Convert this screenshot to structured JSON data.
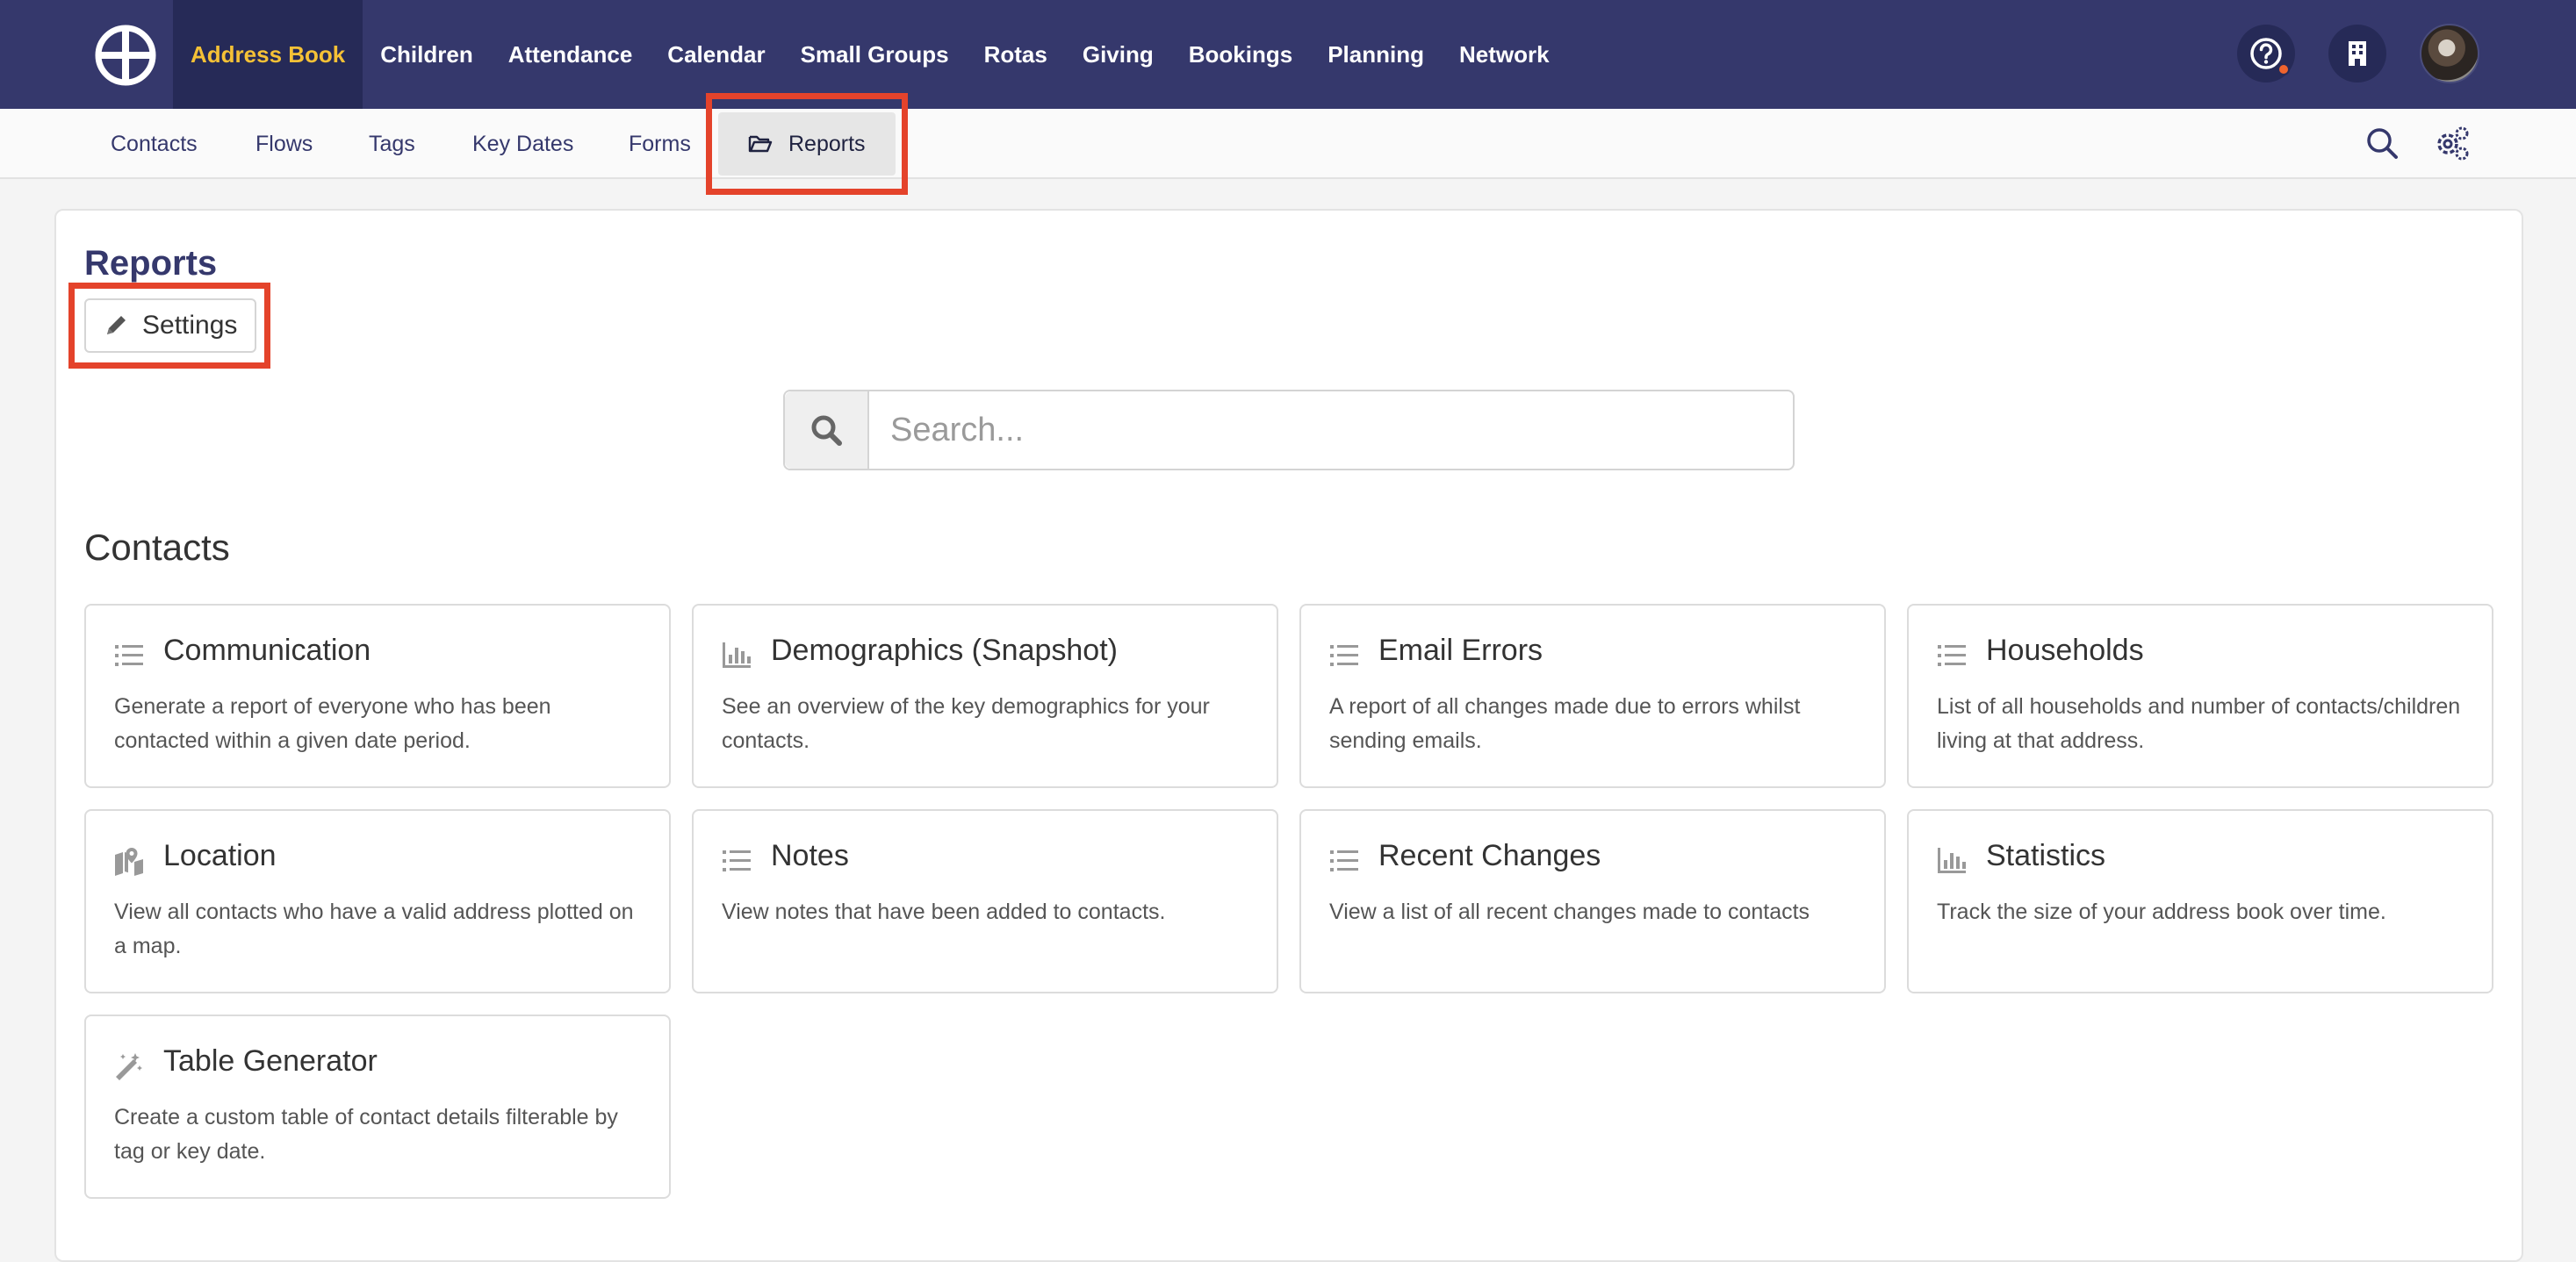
{
  "topnav": {
    "items": [
      {
        "label": "Address Book",
        "active": true
      },
      {
        "label": "Children"
      },
      {
        "label": "Attendance"
      },
      {
        "label": "Calendar"
      },
      {
        "label": "Small Groups"
      },
      {
        "label": "Rotas"
      },
      {
        "label": "Giving"
      },
      {
        "label": "Bookings"
      },
      {
        "label": "Planning"
      },
      {
        "label": "Network"
      }
    ],
    "active_color": "#f5c136",
    "background": "#35386c",
    "icons": [
      "help-icon",
      "building-icon",
      "avatar"
    ]
  },
  "subnav": {
    "items": [
      {
        "label": "Contacts"
      },
      {
        "label": "Flows"
      },
      {
        "label": "Tags"
      },
      {
        "label": "Key Dates"
      },
      {
        "label": "Forms"
      },
      {
        "label": "Reports",
        "active": true,
        "icon": "folder-open-icon"
      }
    ],
    "icons": [
      "search-icon",
      "cogs-icon"
    ]
  },
  "page": {
    "title": "Reports",
    "settings_label": "Settings"
  },
  "search": {
    "placeholder": "Search..."
  },
  "section": {
    "title": "Contacts"
  },
  "cards": [
    {
      "title": "Communication",
      "icon": "list-icon",
      "desc": "Generate a report of everyone who has been contacted within a given date period."
    },
    {
      "title": "Demographics (Snapshot)",
      "icon": "bar-chart-icon",
      "desc": "See an overview of the key demographics for your contacts."
    },
    {
      "title": "Email Errors",
      "icon": "list-icon",
      "desc": "A report of all changes made due to errors whilst sending emails."
    },
    {
      "title": "Households",
      "icon": "list-icon",
      "desc": "List of all households and number of contacts/children living at that address."
    },
    {
      "title": "Location",
      "icon": "map-marker-icon",
      "desc": "View all contacts who have a valid address plotted on a map."
    },
    {
      "title": "Notes",
      "icon": "list-icon",
      "desc": "View notes that have been added to contacts."
    },
    {
      "title": "Recent Changes",
      "icon": "list-icon",
      "desc": "View a list of all recent changes made to contacts"
    },
    {
      "title": "Statistics",
      "icon": "bar-chart-icon",
      "desc": "Track the size of your address book over time."
    },
    {
      "title": "Table Generator",
      "icon": "magic-wand-icon",
      "desc": "Create a custom table of contact details filterable by tag or key date."
    }
  ],
  "highlight_color": "#e4432b"
}
